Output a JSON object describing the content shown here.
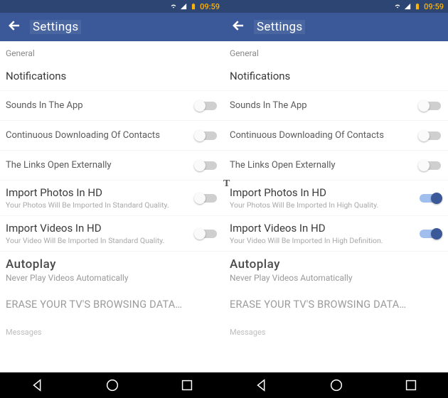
{
  "status": {
    "time": "09:59"
  },
  "appbar": {
    "title": "Settings"
  },
  "left": {
    "section": "General",
    "notifications": "Notifications",
    "sounds": "Sounds In The App",
    "contacts": "Continuous Downloading Of Contacts",
    "links": "The Links Open Externally",
    "photos_lbl": "Import Photos In HD",
    "photos_sub": "Your Photos Will Be Imported In Standard Quality.",
    "videos_lbl": "Import Videos In HD",
    "videos_sub": "Your Video Will Be Imported In Standard Quality.",
    "autoplay_lbl": "Autoplay",
    "autoplay_sub": "Never Play Videos Automatically",
    "erase": "ERASE YOUR TV'S BROWSING DATA…",
    "messages": "Messages"
  },
  "right": {
    "section": "General",
    "notifications": "Notifications",
    "sounds": "Sounds In The App",
    "contacts": "Continuous Downloading Of Contacts",
    "links": "The Links Open Externally",
    "photos_lbl": "Import Photos In HD",
    "photos_sub": "Your Photos Will Be Imported In High Quality.",
    "videos_lbl": "Import Videos In HD",
    "videos_sub": "Your Video Will Be Imported In High Definition.",
    "autoplay_lbl": "Autoplay",
    "autoplay_sub": "Never Play Videos Automatically",
    "erase": "ERASE YOUR TV'S BROWSING DATA…",
    "messages": "Messages"
  },
  "switches": {
    "left": {
      "sounds": false,
      "contacts": false,
      "links": false,
      "photos": false,
      "videos": false
    },
    "right": {
      "sounds": false,
      "contacts": false,
      "links": false,
      "photos": true,
      "videos": true
    }
  }
}
